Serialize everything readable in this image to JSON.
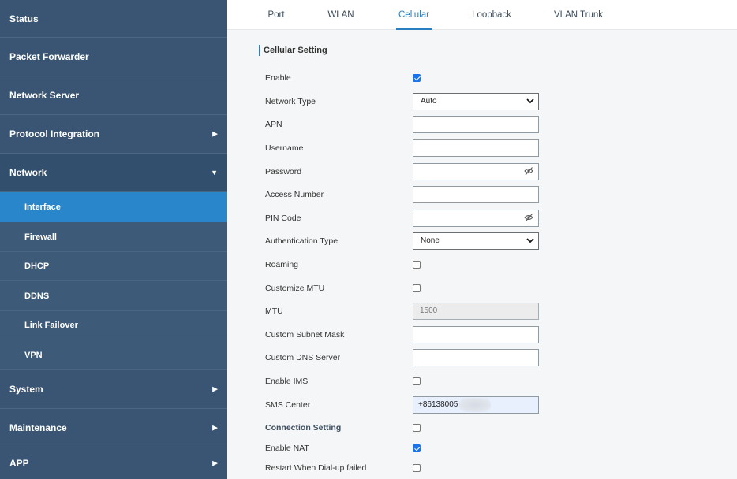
{
  "sidebar": {
    "items": [
      {
        "label": "Status"
      },
      {
        "label": "Packet Forwarder"
      },
      {
        "label": "Network Server"
      },
      {
        "label": "Protocol Integration"
      },
      {
        "label": "Network"
      },
      {
        "label": "System"
      },
      {
        "label": "Maintenance"
      },
      {
        "label": "APP"
      }
    ],
    "network_sub": [
      {
        "label": "Interface"
      },
      {
        "label": "Firewall"
      },
      {
        "label": "DHCP"
      },
      {
        "label": "DDNS"
      },
      {
        "label": "Link Failover"
      },
      {
        "label": "VPN"
      }
    ]
  },
  "tabs": [
    {
      "label": "Port"
    },
    {
      "label": "WLAN"
    },
    {
      "label": "Cellular"
    },
    {
      "label": "Loopback"
    },
    {
      "label": "VLAN Trunk"
    }
  ],
  "section": {
    "title": "Cellular Setting"
  },
  "form": {
    "enable": {
      "label": "Enable",
      "checked": true
    },
    "network_type": {
      "label": "Network Type",
      "value": "Auto"
    },
    "apn": {
      "label": "APN",
      "value": ""
    },
    "username": {
      "label": "Username",
      "value": ""
    },
    "password": {
      "label": "Password",
      "value": ""
    },
    "access_number": {
      "label": "Access Number",
      "value": ""
    },
    "pin_code": {
      "label": "PIN Code",
      "value": ""
    },
    "auth_type": {
      "label": "Authentication Type",
      "value": "None"
    },
    "roaming": {
      "label": "Roaming",
      "checked": false
    },
    "customize_mtu": {
      "label": "Customize MTU",
      "checked": false
    },
    "mtu": {
      "label": "MTU",
      "value": "1500"
    },
    "custom_subnet": {
      "label": "Custom Subnet Mask",
      "value": ""
    },
    "custom_dns": {
      "label": "Custom DNS Server",
      "value": ""
    },
    "enable_ims": {
      "label": "Enable IMS",
      "checked": false
    },
    "sms_center": {
      "label": "SMS Center",
      "value": "+86138005"
    },
    "connection_setting": {
      "label": "Connection Setting",
      "checked": false
    },
    "enable_nat": {
      "label": "Enable NAT",
      "checked": true
    },
    "restart_dialup": {
      "label": "Restart When Dial-up failed",
      "checked": false
    }
  },
  "colors": {
    "sidebar": "#395573",
    "active": "#2a86cb",
    "accent": "#2a7fc0",
    "checkbox": "#1a73e8"
  }
}
